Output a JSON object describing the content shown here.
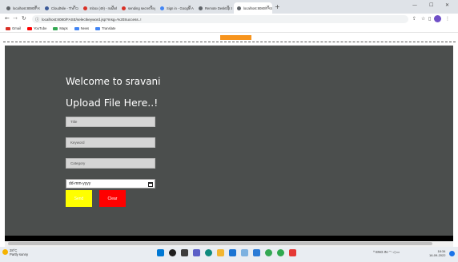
{
  "browser": {
    "tabs": [
      {
        "label": "localhost:8080/FASEr",
        "color": "#5f6368"
      },
      {
        "label": "CloudNile - The Curio",
        "color": "#3b5998"
      },
      {
        "label": "Inbox (49) - maanh?",
        "color": "#d93025"
      },
      {
        "label": "sending secret key -",
        "color": "#d93025"
      },
      {
        "label": "Sign in - Google Acco",
        "color": "#4285f4"
      },
      {
        "label": "Remote Desktop Softw",
        "color": "#5f6368"
      },
      {
        "label": "localhost:8080/FASE",
        "color": "#5f6368",
        "active": true
      }
    ],
    "new_tab": "+",
    "window_controls": {
      "minimize": "—",
      "maximize": "☐",
      "close": "✕"
    },
    "url": "localhost:8080/FASE/selectkeyword.jsp?msg=%20Success..!",
    "bookmarks": [
      {
        "label": "Gmail",
        "color": "#d93025"
      },
      {
        "label": "YouTube",
        "color": "#ff0000"
      },
      {
        "label": "Maps",
        "color": "#34a853"
      },
      {
        "label": "News",
        "color": "#4285f4"
      },
      {
        "label": "Translate",
        "color": "#4285f4"
      }
    ]
  },
  "page": {
    "welcome": "Welcome to sravani",
    "heading": "Upload File Here..!",
    "fields": {
      "title_placeholder": "Title",
      "keyword_placeholder": "Keyword",
      "category_placeholder": "Category",
      "date_placeholder": "dd-mm-yyyy"
    },
    "buttons": {
      "submit_label": "Send",
      "reset_label": "Clear"
    },
    "colors": {
      "background": "#4b4e4d",
      "accent_bar": "#f7941d",
      "submit": "#ffff00",
      "reset": "#ff0000"
    }
  },
  "taskbar": {
    "weather_temp": "28°C",
    "weather_desc": "Partly sunny",
    "apps": [
      {
        "name": "windows-start",
        "color": "#0078d4"
      },
      {
        "name": "search",
        "color": "#1f1f1f"
      },
      {
        "name": "task-view",
        "color": "#3c3c3c"
      },
      {
        "name": "chat",
        "color": "#5b5fc7"
      },
      {
        "name": "edge",
        "color": "#0f8a7e"
      },
      {
        "name": "file-explorer",
        "color": "#f2b632"
      },
      {
        "name": "store",
        "color": "#1b74d3"
      },
      {
        "name": "notepad",
        "color": "#7db1e0"
      },
      {
        "name": "vscode",
        "color": "#2b7bd6"
      },
      {
        "name": "chrome",
        "color": "#34a853"
      },
      {
        "name": "app-green",
        "color": "#2fa84f"
      },
      {
        "name": "app-red",
        "color": "#e53935"
      }
    ],
    "tray_text": "ENG IN",
    "time": "18:34",
    "date": "16-09-2022"
  }
}
